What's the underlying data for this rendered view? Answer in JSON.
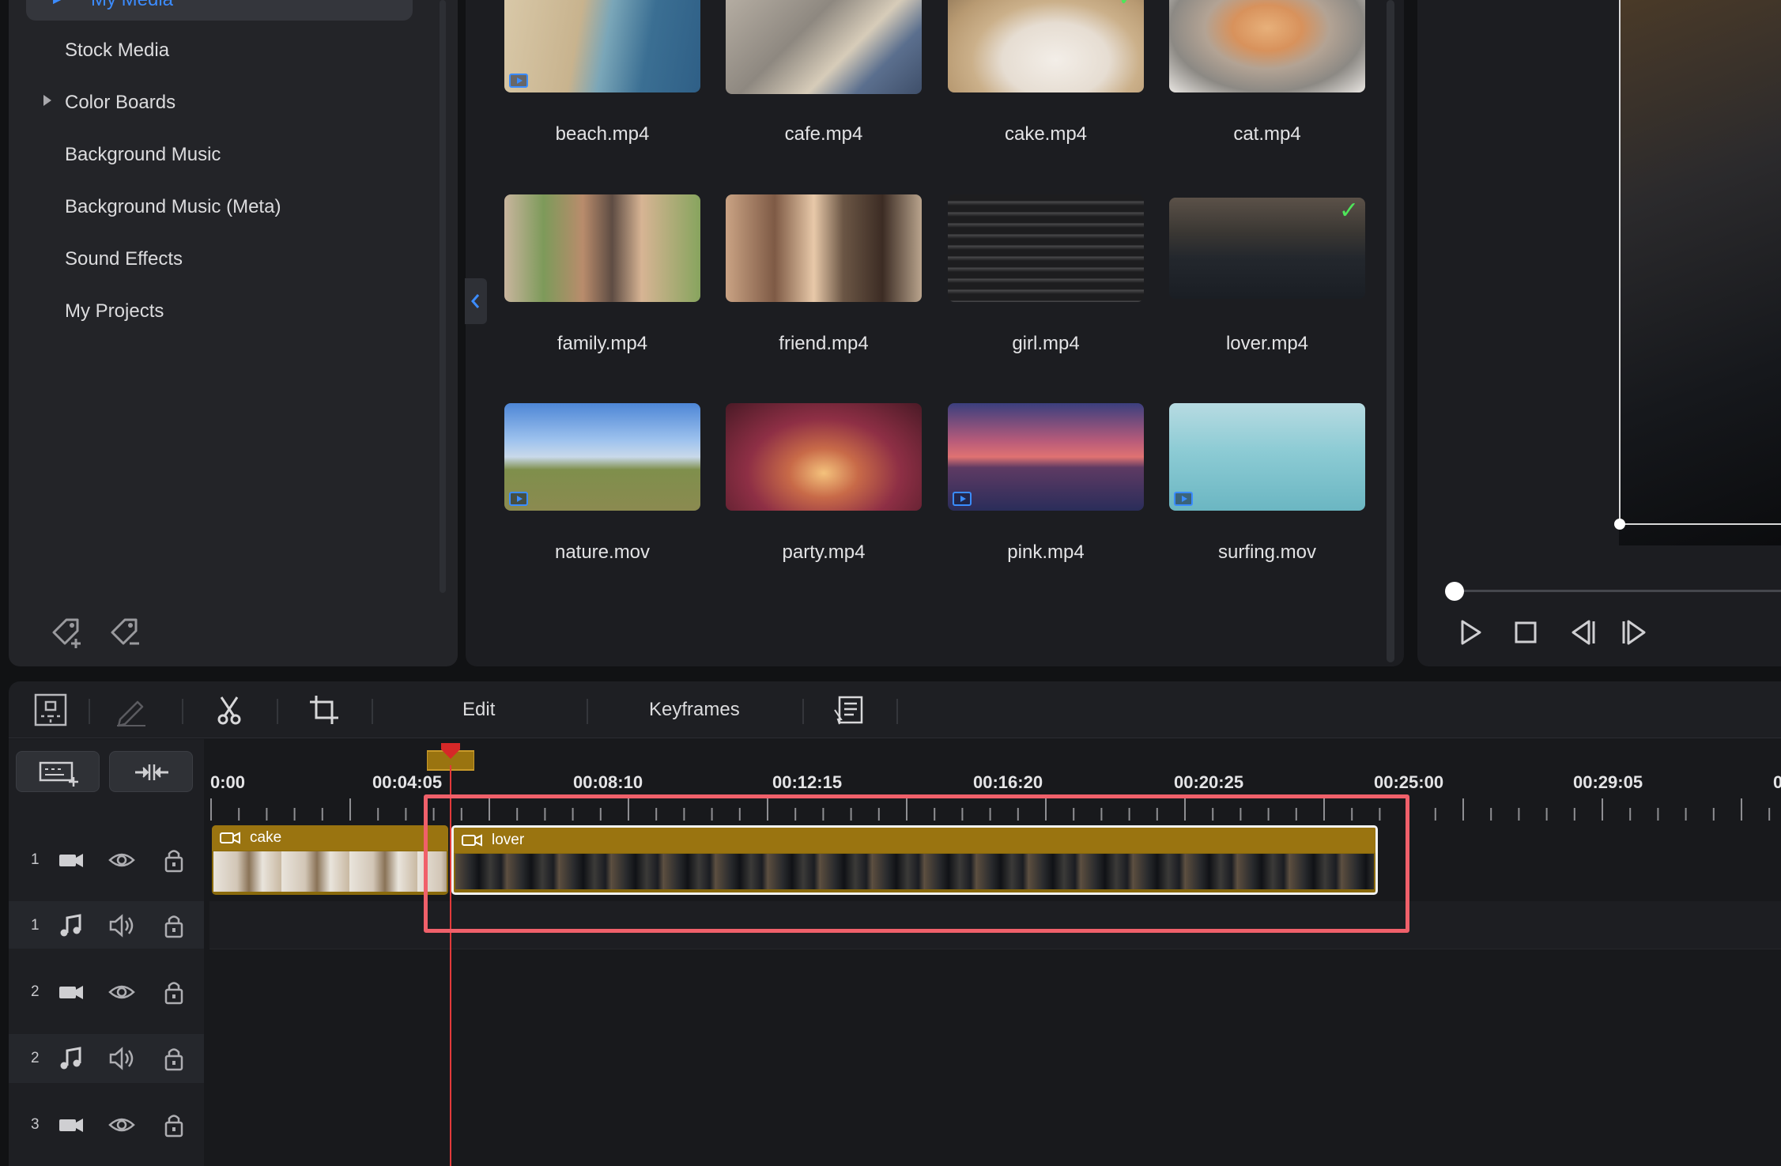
{
  "sidebar": {
    "active_item": "My Media",
    "items": [
      {
        "label": "Stock Media"
      },
      {
        "label": "Color Boards",
        "has_caret": true
      },
      {
        "label": "Background Music"
      },
      {
        "label": "Background Music (Meta)"
      },
      {
        "label": "Sound Effects"
      },
      {
        "label": "My Projects"
      }
    ],
    "icons": [
      "add-tag-icon",
      "remove-tag-icon"
    ]
  },
  "media": {
    "items": [
      {
        "label": "beach.mp4",
        "badge": true,
        "checked": false
      },
      {
        "label": "cafe.mp4",
        "badge": false,
        "checked": false
      },
      {
        "label": "cake.mp4",
        "badge": false,
        "checked": true
      },
      {
        "label": "cat.mp4",
        "badge": false,
        "checked": false
      },
      {
        "label": "family.mp4",
        "badge": false,
        "checked": false
      },
      {
        "label": "friend.mp4",
        "badge": false,
        "checked": false
      },
      {
        "label": "girl.mp4",
        "badge": false,
        "checked": false
      },
      {
        "label": "lover.mp4",
        "badge": false,
        "checked": true
      },
      {
        "label": "nature.mov",
        "badge": true,
        "checked": false
      },
      {
        "label": "party.mp4",
        "badge": false,
        "checked": false
      },
      {
        "label": "pink.mp4",
        "badge": true,
        "checked": false
      },
      {
        "label": "surfing.mov",
        "badge": true,
        "checked": false
      }
    ]
  },
  "preview": {
    "controls": [
      "play-icon",
      "stop-icon",
      "previous-frame-icon",
      "next-frame-icon"
    ]
  },
  "toolbar": {
    "edit_label": "Edit",
    "keyframes_label": "Keyframes"
  },
  "timeline": {
    "time_labels": [
      "0:00",
      "00:04:05",
      "00:08:10",
      "00:12:15",
      "00:16:20",
      "00:20:25",
      "00:25:00",
      "00:29:05",
      "0"
    ],
    "tracks": [
      {
        "number": "1",
        "type": "video"
      },
      {
        "number": "1",
        "type": "audio"
      },
      {
        "number": "2",
        "type": "video"
      },
      {
        "number": "2",
        "type": "audio"
      },
      {
        "number": "3",
        "type": "video"
      }
    ],
    "clips": [
      {
        "name": "cake"
      },
      {
        "name": "lover"
      }
    ]
  },
  "colors": {
    "accent": "#3c8cff",
    "clip": "#9a7410",
    "playhead": "#e23a3a",
    "highlight": "#f0606a",
    "check": "#4ee65a"
  }
}
